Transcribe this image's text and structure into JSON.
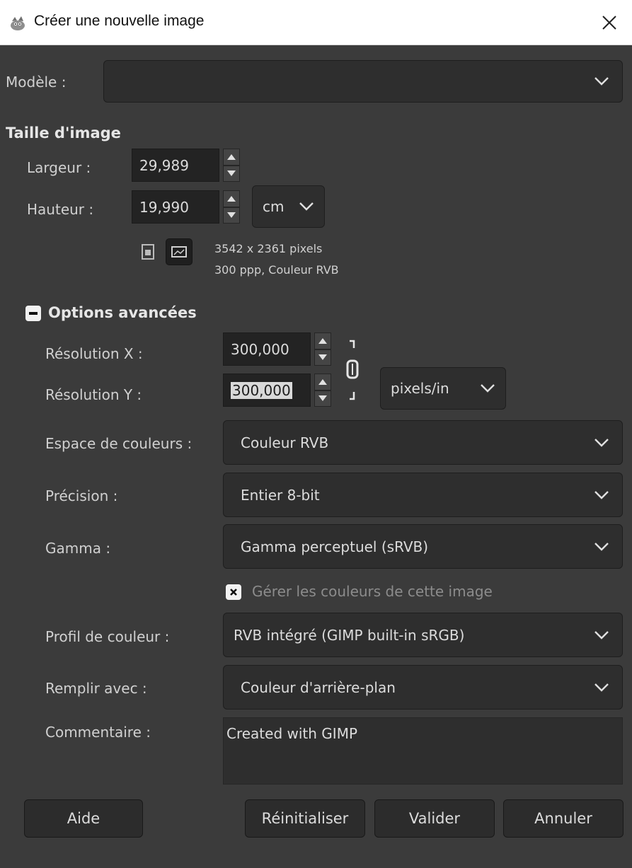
{
  "window": {
    "title": "Créer une nouvelle image"
  },
  "template": {
    "label": "Modèle :",
    "value": ""
  },
  "image_size": {
    "heading": "Taille d'image",
    "width_label": "Largeur :",
    "width_value": "29,989",
    "height_label": "Hauteur :",
    "height_value": "19,990",
    "unit": "cm",
    "info_pixels": "3542 x 2361 pixels",
    "info_details": "300 ppp, Couleur RVB"
  },
  "advanced": {
    "heading": "Options avancées",
    "res_x_label": "Résolution X :",
    "res_x_value": "300,000",
    "res_y_label": "Résolution Y :",
    "res_y_value": "300,000",
    "res_unit": "pixels/in",
    "colorspace_label": "Espace de couleurs :",
    "colorspace_value": "Couleur RVB",
    "precision_label": "Précision :",
    "precision_value": "Entier 8-bit",
    "gamma_label": "Gamma :",
    "gamma_value": "Gamma perceptuel (sRVB)",
    "manage_colors_label": "Gérer les couleurs de cette image",
    "manage_colors_checked": true,
    "profile_label": "Profil de couleur :",
    "profile_value": "RVB intégré (GIMP built-in sRGB)",
    "fill_label": "Remplir avec :",
    "fill_value": "Couleur d'arrière-plan",
    "comment_label": "Commentaire :",
    "comment_value": "Created with GIMP"
  },
  "buttons": {
    "help": "Aide",
    "reset": "Réinitialiser",
    "ok": "Valider",
    "cancel": "Annuler"
  }
}
